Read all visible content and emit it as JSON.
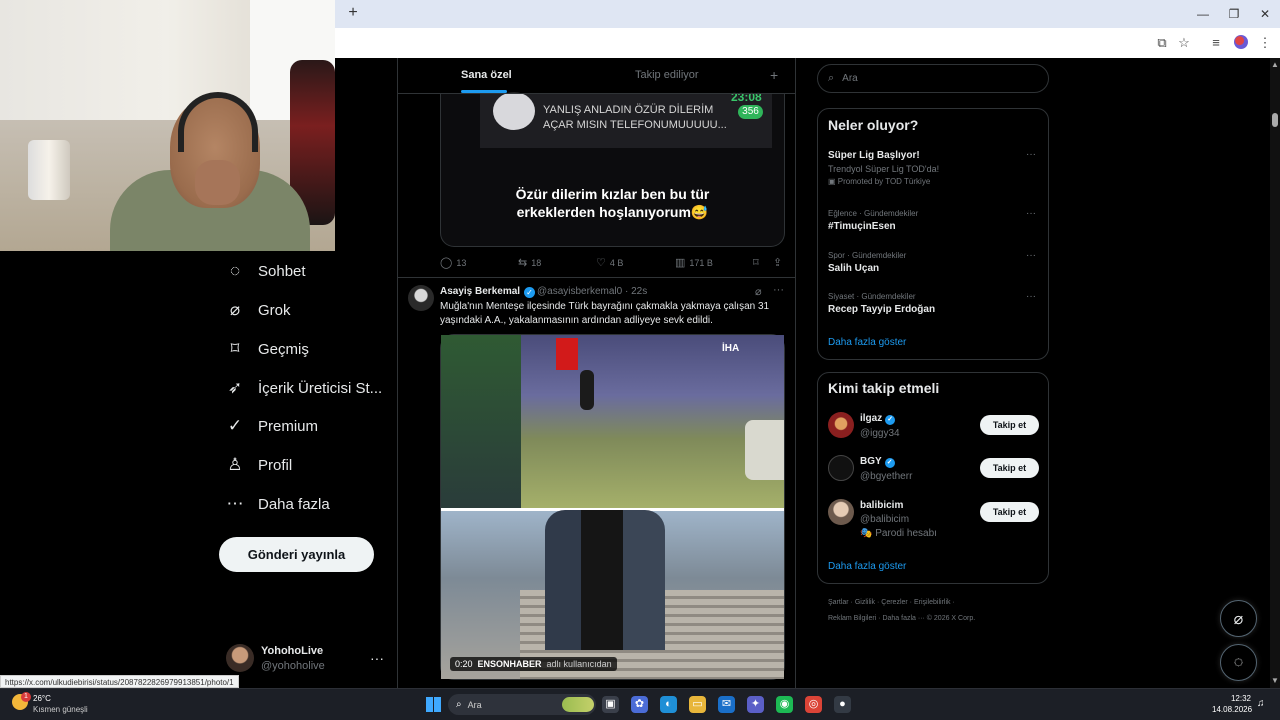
{
  "browser": {
    "new_tab": "+",
    "window_controls": [
      "minimize-icon",
      "restore-icon",
      "close-icon"
    ],
    "window_glyphs": [
      "—",
      "❐",
      "✕"
    ],
    "toolbar_icons": [
      "install-app-icon",
      "bookmark-star-icon",
      "media-controls-icon",
      "profile-icon",
      "menu-icon"
    ],
    "toolbar_glyphs": [
      "⧉",
      "☆",
      "≡",
      "",
      "⋮"
    ]
  },
  "sidebar": {
    "items": [
      {
        "icon": "chat-bubble-icon",
        "glyph": "◌",
        "label": "Sohbet"
      },
      {
        "icon": "grok-icon",
        "glyph": "⌀",
        "label": "Grok"
      },
      {
        "icon": "bookmark-icon",
        "glyph": "⌑",
        "label": "Geçmiş"
      },
      {
        "icon": "rocket-icon",
        "glyph": "➶",
        "label": "İçerik Üreticisi St..."
      },
      {
        "icon": "verified-badge-icon",
        "glyph": "✓",
        "label": "Premium"
      },
      {
        "icon": "person-icon",
        "glyph": "♙",
        "label": "Profil"
      },
      {
        "icon": "more-circle-icon",
        "glyph": "⋯",
        "label": "Daha fazla"
      }
    ],
    "post_button": "Gönderi yayınla",
    "account": {
      "name": "YohohoLive",
      "handle": "@yohoholive",
      "more": "···"
    }
  },
  "feed": {
    "tabs": {
      "for_you": "Sana özel",
      "following": "Takip ediliyor",
      "add": "+"
    },
    "tweet1": {
      "image": {
        "time": "23:08",
        "count": "356",
        "line1": "YANLIŞ ANLADIN ÖZÜR DİLERİM",
        "line2": "AÇAR MISIN TELEFONUMUUUUU...",
        "caption1": "Özür dilerim kızlar ben bu tür",
        "caption2": "erkeklerden hoşlanıyorum😅"
      },
      "actions": {
        "replies": "13",
        "reposts": "18",
        "likes": "4 B",
        "views": "171 B"
      }
    },
    "tweet2": {
      "name": "Asayiş Berkemal",
      "handle_time": "@asayisberkemal0 · 22s",
      "text": "Muğla'nın Menteşe ilçesinde Türk bayrağını çakmakla yakmaya çalışan 31 yaşındaki A.A., yakalanmasının ardından adliyeye sevk edildi.",
      "video": {
        "logo": "İHA",
        "duration": "0:20",
        "source": "ENSONHABER",
        "source_suffix": "adlı kullanıcıdan"
      }
    }
  },
  "right": {
    "search_placeholder": "Ara",
    "trends": {
      "title": "Neler oluyor?",
      "items": [
        {
          "meta": "",
          "title": "Süper Lig Başlıyor!",
          "sub": "Trendyol Süper Lig TOD'da!",
          "promo": "Promoted by TOD Türkiye"
        },
        {
          "meta": "Eğlence · Gündemdekiler",
          "title": "#TimuçinEsen",
          "sub": "",
          "promo": ""
        },
        {
          "meta": "Spor · Gündemdekiler",
          "title": "Salih Uçan",
          "sub": "",
          "promo": ""
        },
        {
          "meta": "Siyaset · Gündemdekiler",
          "title": "Recep Tayyip Erdoğan",
          "sub": "",
          "promo": ""
        }
      ],
      "show_more": "Daha fazla göster"
    },
    "who_to_follow": {
      "title": "Kimi takip etmeli",
      "users": [
        {
          "name": "ilgaz",
          "handle": "@iggy34",
          "verified": true,
          "note": "",
          "button": "Takip et",
          "avatar_color": "#8a1f1f"
        },
        {
          "name": "BGY",
          "handle": "@bgyetherr",
          "verified": true,
          "note": "",
          "button": "Takip et",
          "avatar_color": "#111111"
        },
        {
          "name": "balibicim",
          "handle": "@balibicim",
          "verified": false,
          "note": "🎭 Parodi hesabı",
          "button": "Takip et",
          "avatar_color": "#d9c3b0"
        }
      ],
      "show_more": "Daha fazla göster"
    },
    "footer": {
      "line1": "Şartlar  ·  Gizlilik  ·  Çerezler  ·  Erişilebilirlik  ·",
      "line2": "Reklam Bilgileri  ·  Daha fazla ···  © 2026 X Corp."
    }
  },
  "status_url": "https://x.com/ulkudiebirisi/status/2087822826979913851/photo/1",
  "taskbar": {
    "weather_temp": "26°C",
    "weather_desc": "Kısmen güneşli",
    "weather_alert": "1",
    "search_placeholder": "Ara",
    "apps": [
      {
        "icon": "task-view-icon",
        "glyph": "▣",
        "color": "#3a3f4a"
      },
      {
        "icon": "copilot-icon",
        "glyph": "✿",
        "color": "#4b6cd6"
      },
      {
        "icon": "edge-icon",
        "glyph": "◐",
        "color": "#1f8fd6"
      },
      {
        "icon": "file-explorer-icon",
        "glyph": "▭",
        "color": "#e8b63b"
      },
      {
        "icon": "outlook-icon",
        "glyph": "✉",
        "color": "#1a6fc9"
      },
      {
        "icon": "teams-icon",
        "glyph": "✦",
        "color": "#5b5fc7"
      },
      {
        "icon": "spotify-icon",
        "glyph": "◉",
        "color": "#1db954"
      },
      {
        "icon": "chrome-icon",
        "glyph": "◎",
        "color": "#db4437"
      },
      {
        "icon": "app-icon",
        "glyph": "●",
        "color": "#333a44"
      }
    ],
    "time": "12:32",
    "date": "14.08.2026"
  },
  "colors": {
    "accent": "#1d9bf0",
    "background": "#000000",
    "border": "#2f3336"
  }
}
